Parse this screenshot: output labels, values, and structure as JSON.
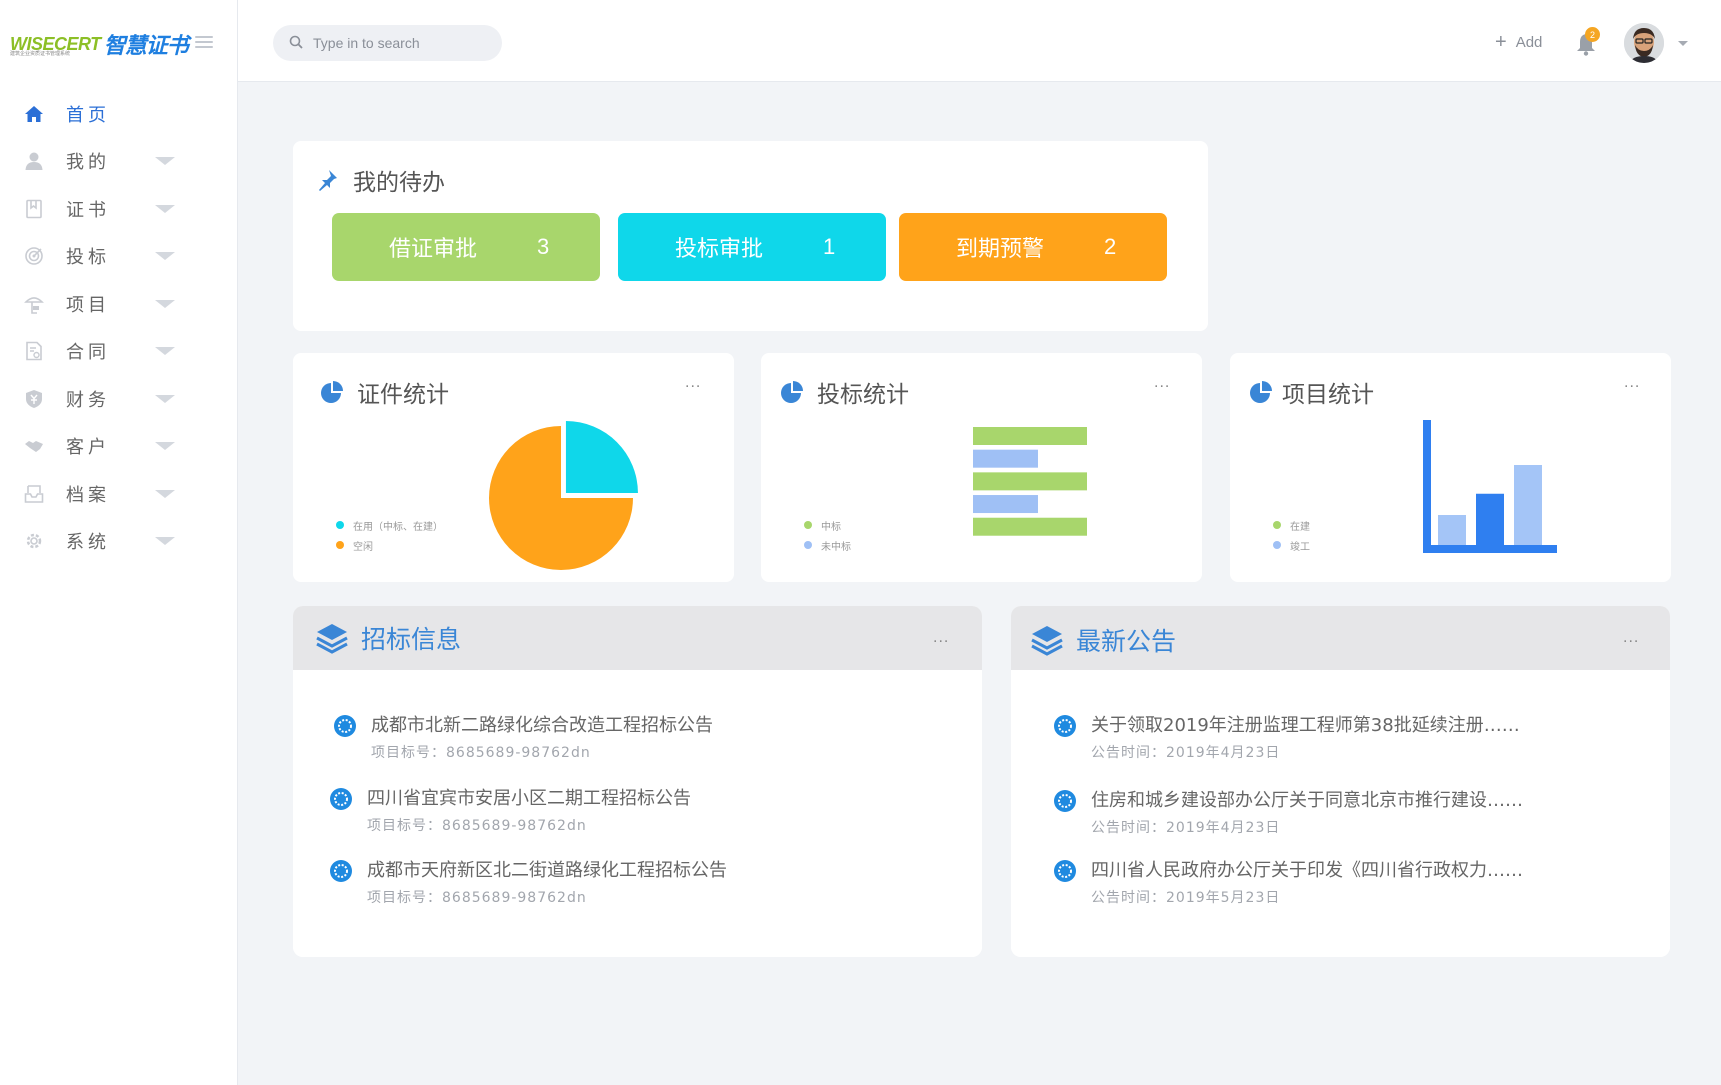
{
  "brand": {
    "logo_en": "WISECERT",
    "logo_cn": "智慧证书",
    "logo_sub": "建筑企业资质证书管理系统"
  },
  "sidebar": {
    "items": [
      {
        "label": "首页",
        "icon": "home-icon"
      },
      {
        "label": "我的",
        "icon": "user-icon"
      },
      {
        "label": "证书",
        "icon": "certificate-icon"
      },
      {
        "label": "投标",
        "icon": "target-icon"
      },
      {
        "label": "项目",
        "icon": "project-icon"
      },
      {
        "label": "合同",
        "icon": "contract-icon"
      },
      {
        "label": "财务",
        "icon": "finance-shield-icon"
      },
      {
        "label": "客户",
        "icon": "handshake-icon"
      },
      {
        "label": "档案",
        "icon": "archive-inbox-icon"
      },
      {
        "label": "系统",
        "icon": "settings-gear-icon"
      }
    ]
  },
  "header": {
    "search_placeholder": "Type in to search",
    "add_label": "Add",
    "notification_count": "2"
  },
  "todo": {
    "title": "我的待办",
    "buttons": [
      {
        "label": "借证审批",
        "count": "3",
        "color": "#a8d66c"
      },
      {
        "label": "投标审批",
        "count": "1",
        "color": "#0fd7ea"
      },
      {
        "label": "到期预警",
        "count": "2",
        "color": "#ffa31a"
      }
    ]
  },
  "stats": {
    "more": "...",
    "cert": {
      "title": "证件统计",
      "legend": [
        "在用（中标、在建）",
        "空闲"
      ]
    },
    "bid": {
      "title": "投标统计",
      "legend": [
        "中标",
        "未中标"
      ]
    },
    "project": {
      "title": "项目统计",
      "legend": [
        "在建",
        "竣工"
      ]
    }
  },
  "chart_data": [
    {
      "type": "pie",
      "title": "证件统计",
      "labels": [
        "在用（中标、在建）",
        "空闲"
      ],
      "values": [
        25,
        75
      ],
      "colors": [
        "#0fd7ea",
        "#ffa31a"
      ]
    },
    {
      "type": "bar",
      "orientation": "horizontal",
      "title": "投标统计",
      "series": [
        {
          "name": "中标",
          "values": [
            100,
            100,
            100
          ],
          "color": "#a8d66c"
        },
        {
          "name": "未中标",
          "values": [
            57,
            57
          ],
          "color": "#9fc0f5"
        }
      ]
    },
    {
      "type": "bar",
      "title": "项目统计",
      "series": [
        {
          "name": "在建",
          "values": [
            100,
            24,
            41,
            64
          ],
          "colors": [
            "#2f7ff0",
            "#a4c5f7",
            "#2f7ff0",
            "#a4c5f7"
          ]
        }
      ]
    }
  ],
  "bidding": {
    "title": "招标信息",
    "items": [
      {
        "title": "成都市北新二路绿化综合改造工程招标公告",
        "sub": "项目标号：8685689-98762dn"
      },
      {
        "title": "四川省宜宾市安居小区二期工程招标公告",
        "sub": "项目标号：8685689-98762dn"
      },
      {
        "title": "成都市天府新区北二街道路绿化工程招标公告",
        "sub": "项目标号：8685689-98762dn"
      }
    ]
  },
  "notices": {
    "title": "最新公告",
    "items": [
      {
        "title": "关于领取2019年注册监理工程师第38批延续注册……",
        "sub": "公告时间：2019年4月23日"
      },
      {
        "title": "住房和城乡建设部办公厅关于同意北京市推行建设……",
        "sub": "公告时间：2019年4月23日"
      },
      {
        "title": "四川省人民政府办公厅关于印发《四川省行政权力……",
        "sub": "公告时间：2019年5月23日"
      }
    ]
  }
}
